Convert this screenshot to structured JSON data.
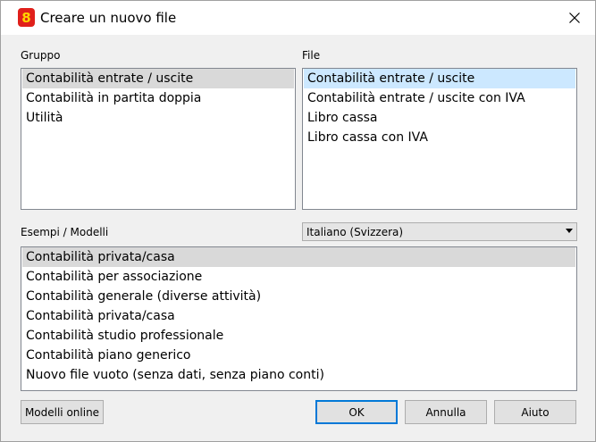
{
  "window": {
    "title": "Creare un nuovo file"
  },
  "group": {
    "label": "Gruppo",
    "items": [
      "Contabilità entrate / uscite",
      "Contabilità in partita doppia",
      "Utilità"
    ],
    "selected": 0
  },
  "file": {
    "label": "File",
    "items": [
      "Contabilità entrate / uscite",
      "Contabilità entrate / uscite con IVA",
      "Libro cassa",
      "Libro cassa con IVA"
    ],
    "selected": 0
  },
  "examples": {
    "label": "Esempi / Modelli",
    "language": "Italiano (Svizzera)",
    "items": [
      "Contabilità privata/casa",
      "Contabilità per associazione",
      "Contabilità generale (diverse attività)",
      "Contabilità privata/casa",
      "Contabilità studio professionale",
      "Contabilità piano generico",
      "Nuovo file vuoto (senza dati, senza piano conti)"
    ],
    "selected": 0
  },
  "buttons": {
    "online": "Modelli online",
    "ok": "OK",
    "cancel": "Annulla",
    "help": "Aiuto"
  }
}
